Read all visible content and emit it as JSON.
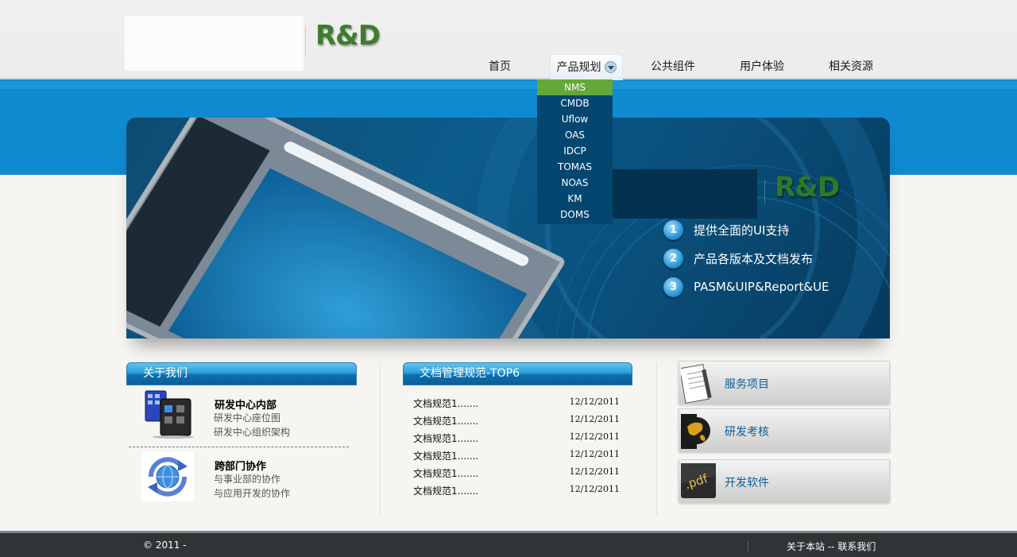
{
  "header": {
    "logo_text": "R&D",
    "nav": [
      {
        "label": "首页"
      },
      {
        "label": "产品规划"
      },
      {
        "label": "公共组件"
      },
      {
        "label": "用户体验"
      },
      {
        "label": "相关资源"
      }
    ]
  },
  "dropdown": {
    "items": [
      "NMS",
      "CMDB",
      "Uflow",
      "OAS",
      "IDCP",
      "TOMAS",
      "NOAS",
      "KM",
      "DOMS"
    ],
    "active_item": "NMS"
  },
  "banner": {
    "logo_text": "R&D",
    "features": [
      {
        "num": "1",
        "text": "提供全面的UI支持"
      },
      {
        "num": "2",
        "text": "产品各版本及文档发布"
      },
      {
        "num": "3",
        "text": "PASM&UIP&Report&UE"
      }
    ]
  },
  "about": {
    "heading": "关于我们",
    "blocks": [
      {
        "title": "研发中心内部",
        "links": [
          "研发中心座位图",
          "研发中心组织架构"
        ]
      },
      {
        "title": "跨部门协作",
        "links": [
          "与事业部的协作",
          "与应用开发的协作"
        ]
      }
    ]
  },
  "docs": {
    "heading": "文档管理规范-TOP6",
    "rows": [
      {
        "title": "文档规范1.......",
        "date": "12/12/2011"
      },
      {
        "title": "文档规范1.......",
        "date": "12/12/2011"
      },
      {
        "title": "文档规范1.......",
        "date": "12/12/2011"
      },
      {
        "title": "文档规范1.......",
        "date": "12/12/2011"
      },
      {
        "title": "文档规范1.......",
        "date": "12/12/2011"
      },
      {
        "title": "文档规范1.......",
        "date": "12/12/2011"
      }
    ]
  },
  "services": [
    {
      "label": "服务项目",
      "icon": "notepad-pen-icon"
    },
    {
      "label": "研发考核",
      "icon": "globe-icon"
    },
    {
      "label": "开发软件",
      "icon": "pdf-icon"
    }
  ],
  "footer": {
    "copyright": "© 2011 -",
    "about_link": "关于本站",
    "separator": " -- ",
    "contact_link": "联系我们"
  },
  "colors": {
    "accent_blue": "#0f8ad0",
    "banner_dark": "#0c5c8c",
    "brand_green": "#3f7c2c",
    "dropdown_bg": "#03466f",
    "dropdown_active": "#62a93a",
    "footer_bg": "#2f3437"
  }
}
